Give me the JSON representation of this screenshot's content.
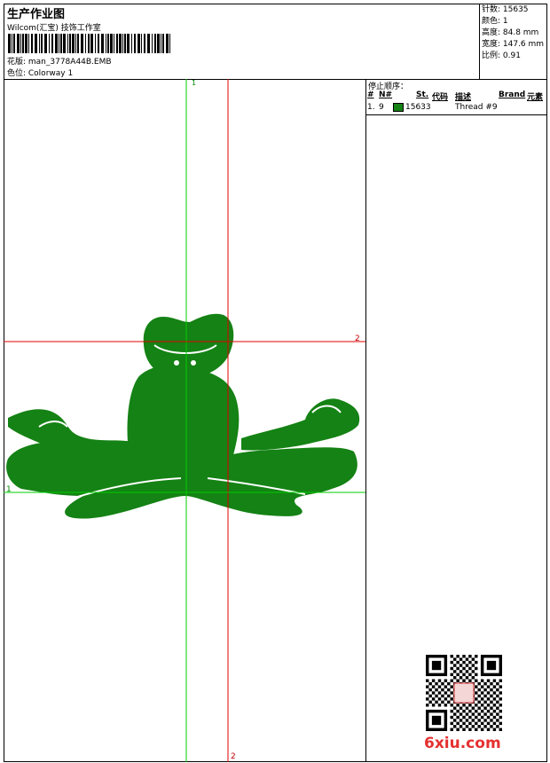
{
  "header": {
    "title": "生产作业图",
    "company": "Wilcom(汇宝) 技饰工作室",
    "design_line": "花版: man_3778A44B.EMB",
    "colorway_line": "色位: Colorway 1"
  },
  "specs": {
    "stitches": "针数: 15635",
    "colors": "颜色: 1",
    "height": "高度: 84.8 mm",
    "width": "宽度: 147.6 mm",
    "scale": "比例: 0.91"
  },
  "stop_sequence": {
    "title": "停止顺序：",
    "headers": {
      "hash": "#",
      "number": "N#",
      "stitches": "St.",
      "code": "代码",
      "description": "描述",
      "brand": "Brand",
      "element": "元素"
    },
    "rows": [
      {
        "index": "1.",
        "number": "9",
        "stitches": "15633",
        "description": "Thread #9",
        "color": "#148214"
      }
    ]
  },
  "guides": {
    "v1_label": "1",
    "v2_label": "2",
    "h1_label": "1",
    "h2_label": "2",
    "color_green": "#00cc00",
    "color_red": "#e00000"
  },
  "design": {
    "fill": "#148214",
    "icon": "meditating-frog-embroidery"
  },
  "watermark": {
    "text": "6xiu.com",
    "color": "#e53030"
  }
}
